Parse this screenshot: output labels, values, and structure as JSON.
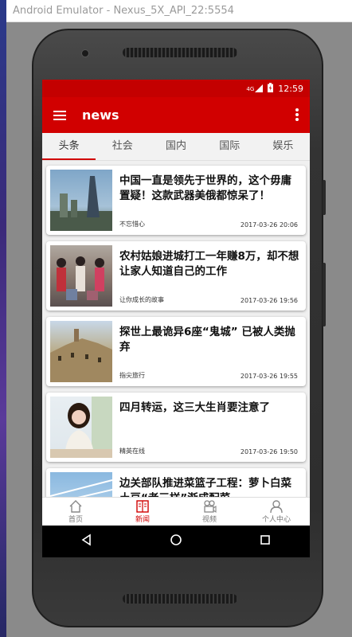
{
  "window": {
    "title": "Android Emulator - Nexus_5X_API_22:5554"
  },
  "statusbar": {
    "signal": "4G",
    "time": "12:59"
  },
  "toolbar": {
    "title": "news"
  },
  "tabs": [
    {
      "label": "头条"
    },
    {
      "label": "社会"
    },
    {
      "label": "国内"
    },
    {
      "label": "国际"
    },
    {
      "label": "娱乐"
    }
  ],
  "articles": [
    {
      "title": "中国一直是领先于世界的，这个毋庸置疑！这款武器美俄都惊呆了！",
      "source": "不忘惜心",
      "time": "2017-03-26 20:06"
    },
    {
      "title": "农村姑娘进城打工一年赚8万，却不想让家人知道自己的工作",
      "source": "让你成长的故事",
      "time": "2017-03-26 19:56"
    },
    {
      "title": "探世上最诡异6座“鬼城” 已被人类抛弃",
      "source": "指尖旅行",
      "time": "2017-03-26 19:55"
    },
    {
      "title": "四月转运，这三大生肖要注意了",
      "source": "精英在线",
      "time": "2017-03-26 19:50"
    },
    {
      "title": "边关部队推进菜篮子工程：萝卜白菜土豆“老三样”渐成配菜",
      "source": "",
      "time": ""
    }
  ],
  "bottom_nav": [
    {
      "label": "首页",
      "icon": "home-icon"
    },
    {
      "label": "新闻",
      "icon": "news-icon"
    },
    {
      "label": "视频",
      "icon": "video-icon"
    },
    {
      "label": "个人中心",
      "icon": "person-icon"
    }
  ],
  "colors": {
    "primary": "#d10000",
    "statusbar": "#c40000"
  }
}
